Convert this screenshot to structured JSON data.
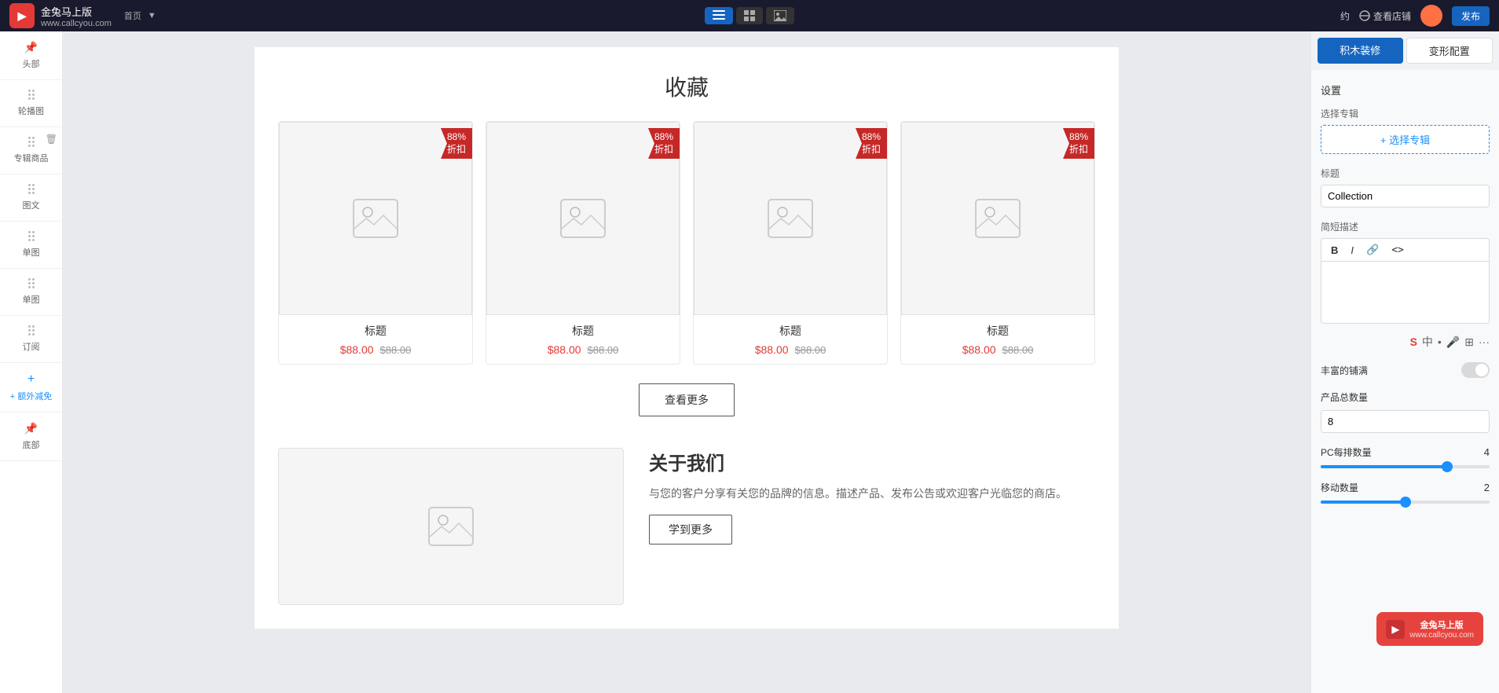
{
  "topbar": {
    "logo_text": "金兔马上版",
    "logo_sub": "www.callcyou.com",
    "nav_items": [
      {
        "label": "首页",
        "active": true
      },
      {
        "label": "▼",
        "active": false
      }
    ],
    "view_label": "查看店铺",
    "publish_label": "发布",
    "reserve_label": "约"
  },
  "sidebar": {
    "items": [
      {
        "label": "头部",
        "pin": true
      },
      {
        "label": "轮播图",
        "draggable": true
      },
      {
        "label": "专辑商品",
        "draggable": true,
        "has_delete": true
      },
      {
        "label": "图文",
        "draggable": true
      },
      {
        "label": "单图",
        "draggable": true
      },
      {
        "label": "单图",
        "draggable": true
      },
      {
        "label": "订阅",
        "draggable": true
      },
      {
        "label": "+ 额外减免",
        "add": true
      },
      {
        "label": "底部",
        "pin": true
      }
    ]
  },
  "canvas": {
    "section_title": "收藏",
    "products": [
      {
        "title": "标题",
        "price": "$88.00",
        "original": "$88.00",
        "discount": "88%\n折扣"
      },
      {
        "title": "标题",
        "price": "$88.00",
        "original": "$88.00",
        "discount": "88%\n折扣"
      },
      {
        "title": "标题",
        "price": "$88.00",
        "original": "$88.00",
        "discount": "88%\n折扣"
      },
      {
        "title": "标题",
        "price": "$88.00",
        "original": "$88.00",
        "discount": "88%\n折扣"
      }
    ],
    "view_more_label": "查看更多",
    "about_title": "关于我们",
    "about_desc": "与您的客户分享有关您的品牌的信息。描述产品、发布公告或欢迎客户光临您的商店。",
    "learn_more_label": "学到更多"
  },
  "right_panel": {
    "tab_block": "积木装修",
    "tab_style": "变形配置",
    "settings_label": "设置",
    "select_album_label": "选择专辑",
    "select_album_btn": "+ 选择专辑",
    "title_label": "标题",
    "title_value": "Collection",
    "desc_label": "简短描述",
    "rich_toolbar": {
      "bold": "B",
      "italic": "I",
      "link": "🔗",
      "code": "<>"
    },
    "rich_text_placeholder": "",
    "rich_suffix_label": "丰富的铺满",
    "toggle_state": false,
    "product_count_label": "产品总数量",
    "product_count_value": "8",
    "pc_per_row_label": "PC每排数量",
    "pc_per_row_value": "4",
    "pc_slider_pct": 75,
    "mobile_per_row_label": "移动数量",
    "mobile_per_row_value": "2",
    "mobile_slider_pct": 50
  },
  "watermark": {
    "text": "www.callcyou.com"
  }
}
